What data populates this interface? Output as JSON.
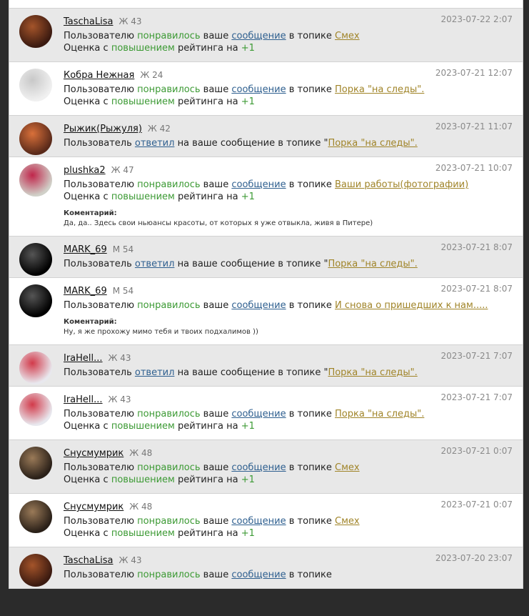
{
  "labels": {
    "liked_prefix": "Пользователю",
    "liked_word": "понравилось",
    "liked_your": "ваше",
    "message_link": "сообщение",
    "in_topic": "в топике",
    "rating_prefix": "Оценка с",
    "rating_up": "повышением",
    "rating_middle": "рейтинга на",
    "replied_prefix": "Пользователь",
    "replied_word": "ответил",
    "replied_rest": "на ваше сообщение в топике",
    "comment_title": "Коментарий:"
  },
  "notifications": [
    {
      "user": "TaschaLisa",
      "age": "Ж 43",
      "date": "2023-07-22 2:07",
      "type": "liked",
      "topic": "Смех",
      "rating": "+1",
      "bg": "gray",
      "avatar_colors": [
        "#3b1a10",
        "#a4542a"
      ]
    },
    {
      "user": "Кобра Нежная",
      "age": "Ж 24",
      "date": "2023-07-21 12:07",
      "type": "liked",
      "topic": "Порка \"на следы\".",
      "rating": "+1",
      "bg": "white",
      "avatar_colors": [
        "#f0f0f0",
        "#c8c8c8"
      ]
    },
    {
      "user": "Рыжик(Рыжуля)",
      "age": "Ж 42",
      "date": "2023-07-21 11:07",
      "type": "replied",
      "topic": "Порка \"на следы\".",
      "bg": "gray",
      "avatar_colors": [
        "#5a2a1a",
        "#d9703a"
      ]
    },
    {
      "user": "plushka2",
      "age": "Ж 47",
      "date": "2023-07-21 10:07",
      "type": "liked",
      "topic": "Ваши работы(фотографии)",
      "rating": "+1",
      "bg": "white",
      "avatar_colors": [
        "#d0d0c8",
        "#c0264b"
      ],
      "comment": "Да, да.. Здесь свои ньюансы красоты, от которых я уже отвыкла, живя в Питере)"
    },
    {
      "user": "MARK_69",
      "age": "М 54",
      "date": "2023-07-21 8:07",
      "type": "replied",
      "topic": "Порка \"на следы\".",
      "bg": "gray",
      "avatar_colors": [
        "#000000",
        "#555555"
      ]
    },
    {
      "user": "MARK_69",
      "age": "М 54",
      "date": "2023-07-21 8:07",
      "type": "liked",
      "topic": "И снова о пришедших к нам.....",
      "rating": "",
      "bg": "white",
      "avatar_colors": [
        "#000000",
        "#555555"
      ],
      "comment": "Ну, я же прохожу мимо тебя и твоих подхалимов ))"
    },
    {
      "user": "IraHell...",
      "age": "Ж 43",
      "date": "2023-07-21 7:07",
      "type": "replied",
      "topic": "Порка \"на следы\".",
      "bg": "gray",
      "avatar_colors": [
        "#e8e8ee",
        "#d23a4a"
      ]
    },
    {
      "user": "IraHell...",
      "age": "Ж 43",
      "date": "2023-07-21 7:07",
      "type": "liked",
      "topic": "Порка \"на следы\".",
      "rating": "+1",
      "bg": "white",
      "avatar_colors": [
        "#e8e8ee",
        "#d23a4a"
      ]
    },
    {
      "user": "Снусмумрик",
      "age": "Ж 48",
      "date": "2023-07-21 0:07",
      "type": "liked",
      "topic": "Смех",
      "rating": "+1",
      "bg": "gray",
      "avatar_colors": [
        "#2a2018",
        "#9a7a58"
      ]
    },
    {
      "user": "Снусмумрик",
      "age": "Ж 48",
      "date": "2023-07-21 0:07",
      "type": "liked",
      "topic": "Смех",
      "rating": "+1",
      "bg": "white",
      "avatar_colors": [
        "#2a2018",
        "#9a7a58"
      ]
    },
    {
      "user": "TaschaLisa",
      "age": "Ж 43",
      "date": "2023-07-20 23:07",
      "type": "liked",
      "topic": "",
      "rating": "",
      "bg": "gray",
      "avatar_colors": [
        "#3b1a10",
        "#a4542a"
      ]
    }
  ]
}
